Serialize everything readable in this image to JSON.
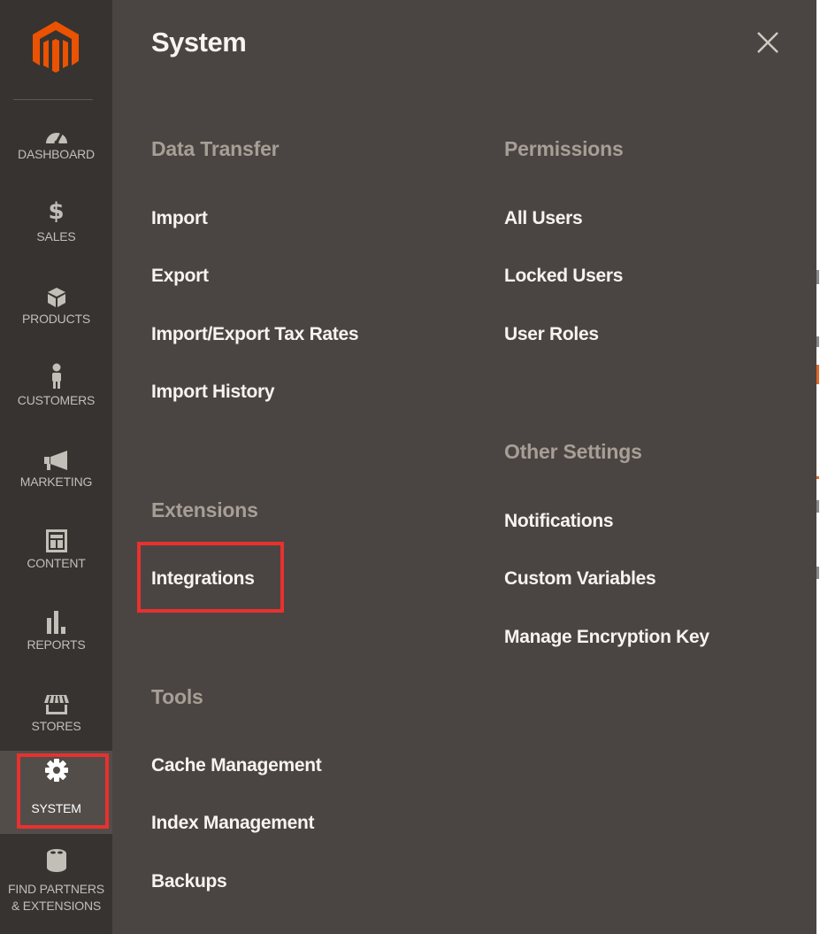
{
  "sidebar": {
    "logo_icon": "magento-logo",
    "items": [
      {
        "label": "DASHBOARD",
        "icon": "gauge-icon"
      },
      {
        "label": "$",
        "sub": "SALES",
        "icon": "dollar-icon"
      },
      {
        "label": "PRODUCTS",
        "icon": "cube-icon"
      },
      {
        "label": "CUSTOMERS",
        "icon": "person-icon"
      },
      {
        "label": "MARKETING",
        "icon": "megaphone-icon"
      },
      {
        "label": "CONTENT",
        "icon": "layout-icon"
      },
      {
        "label": "REPORTS",
        "icon": "bar-chart-icon"
      },
      {
        "label": "STORES",
        "icon": "storefront-icon"
      },
      {
        "label": "SYSTEM",
        "icon": "gear-icon"
      },
      {
        "label": "FIND PARTNERS",
        "label2": "& EXTENSIONS",
        "icon": "lego-brick-icon"
      }
    ]
  },
  "panel": {
    "title": "System",
    "close_icon": "close-icon",
    "left_column": {
      "data_transfer": {
        "title": "Data Transfer",
        "links": [
          "Import",
          "Export",
          "Import/Export Tax Rates",
          "Import History"
        ]
      },
      "extensions": {
        "title": "Extensions",
        "links": [
          "Integrations"
        ]
      },
      "tools": {
        "title": "Tools",
        "links": [
          "Cache Management",
          "Index Management",
          "Backups"
        ]
      }
    },
    "right_column": {
      "permissions": {
        "title": "Permissions",
        "links": [
          "All Users",
          "Locked Users",
          "User Roles"
        ]
      },
      "other_settings": {
        "title": "Other Settings",
        "links": [
          "Notifications",
          "Custom Variables",
          "Manage Encryption Key"
        ]
      }
    }
  },
  "colors": {
    "sidebar_bg": "#373330",
    "panel_bg": "#4a4542",
    "section_title": "#a79e96",
    "link_text": "#f7f3ee",
    "brand_orange": "#eb5202",
    "highlight_red": "#e8312f"
  }
}
